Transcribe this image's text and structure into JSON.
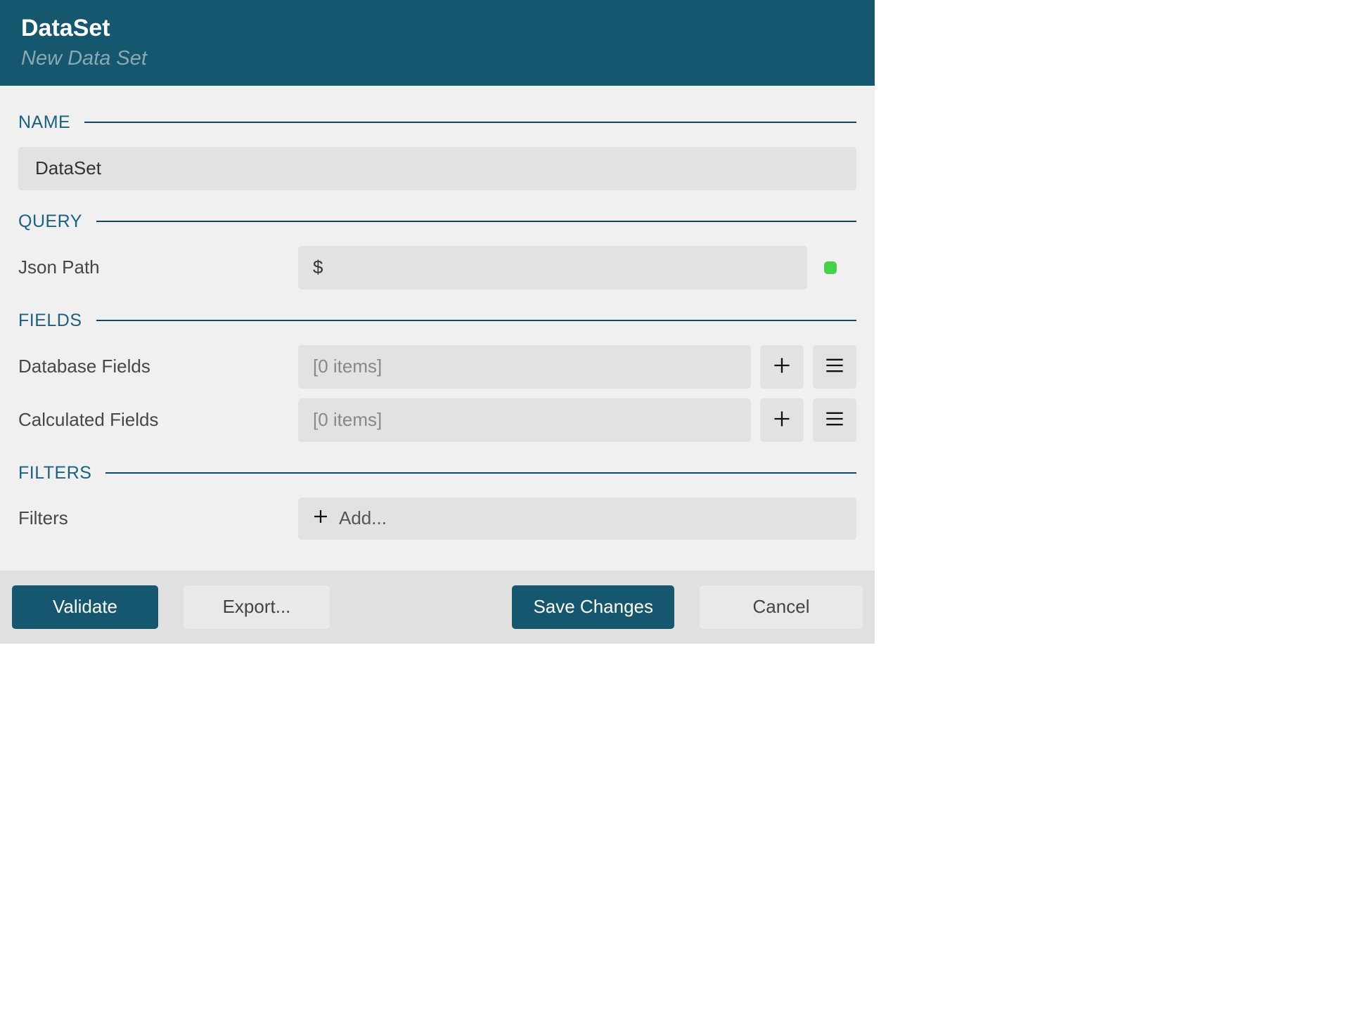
{
  "header": {
    "title": "DataSet",
    "subtitle": "New Data Set"
  },
  "sections": {
    "name": {
      "label": "NAME"
    },
    "query": {
      "label": "QUERY"
    },
    "fields": {
      "label": "FIELDS"
    },
    "filters": {
      "label": "FILTERS"
    }
  },
  "name_input": {
    "value": "DataSet"
  },
  "query": {
    "json_path": {
      "label": "Json Path",
      "value": "$"
    }
  },
  "fields": {
    "database": {
      "label": "Database Fields",
      "placeholder": "[0 items]"
    },
    "calculated": {
      "label": "Calculated Fields",
      "placeholder": "[0 items]"
    }
  },
  "filters": {
    "label": "Filters",
    "add_label": "Add..."
  },
  "footer": {
    "validate": "Validate",
    "export": "Export...",
    "save": "Save Changes",
    "cancel": "Cancel"
  },
  "colors": {
    "brand": "#15576f",
    "section_accent": "#1a6182",
    "status_ok": "#46d14b"
  }
}
